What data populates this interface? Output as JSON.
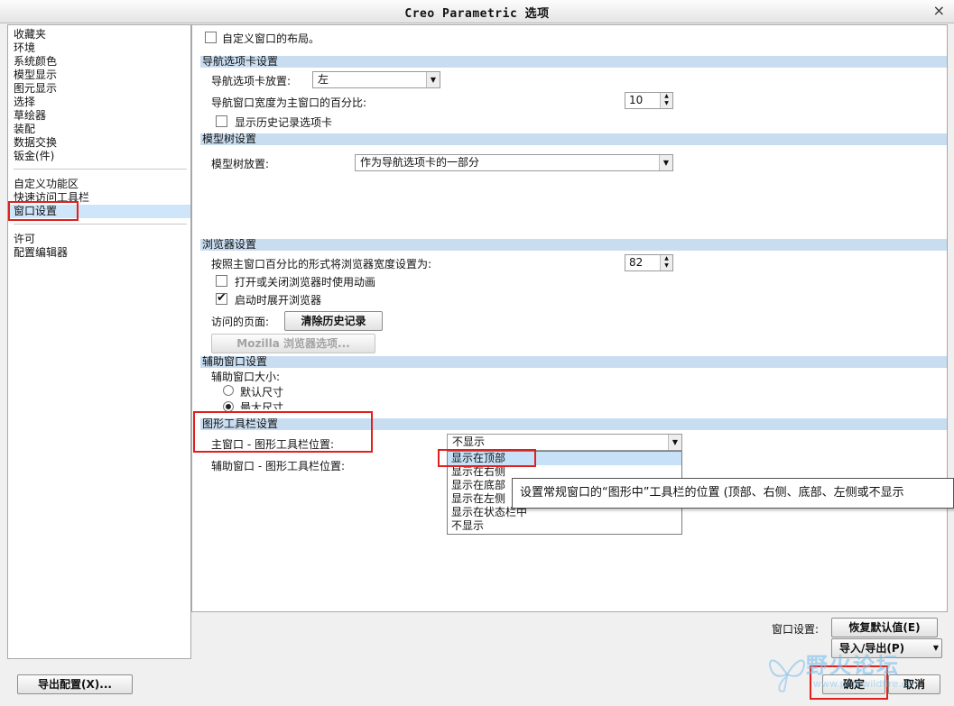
{
  "window": {
    "title": "Creo Parametric 选项",
    "close_glyph": "×"
  },
  "left_nav": {
    "group1": [
      "收藏夹",
      "环境",
      "系统颜色",
      "模型显示",
      "图元显示",
      "选择",
      "草绘器",
      "装配",
      "数据交换",
      "钣金(件)"
    ],
    "group2": [
      "自定义功能区",
      "快速访问工具栏",
      "窗口设置"
    ],
    "group3": [
      "许可",
      "配置编辑器"
    ],
    "selected": "窗口设置"
  },
  "main": {
    "custom_layout_label": "自定义窗口的布局。",
    "nav_section": {
      "header": "导航选项卡设置",
      "placement_label": "导航选项卡放置:",
      "placement_value": "左",
      "width_label": "导航窗口宽度为主窗口的百分比:",
      "width_value": "10",
      "history_label": "显示历史记录选项卡"
    },
    "tree_section": {
      "header": "模型树设置",
      "placement_label": "模型树放置:",
      "placement_value": "作为导航选项卡的一部分"
    },
    "browser_section": {
      "header": "浏览器设置",
      "width_label": "按照主窗口百分比的形式将浏览器宽度设置为:",
      "width_value": "82",
      "animate_label": "打开或关闭浏览器时使用动画",
      "expand_label": "启动时展开浏览器",
      "visited_label": "访问的页面:",
      "clear_history_label": "清除历史记录",
      "mozilla_label": "Mozilla 浏览器选项..."
    },
    "aux_section": {
      "header": "辅助窗口设置",
      "size_label": "辅助窗口大小:",
      "default_size_label": "默认尺寸",
      "max_size_label": "最大尺寸"
    },
    "graphics_section": {
      "header": "图形工具栏设置",
      "main_label": "主窗口 - 图形工具栏位置:",
      "main_value": "不显示",
      "aux_label": "辅助窗口 - 图形工具栏位置:",
      "options": [
        "显示在顶部",
        "显示在右侧",
        "显示在底部",
        "显示在左侧",
        "显示在状态栏中",
        "不显示"
      ]
    },
    "tooltip": "设置常规窗口的“图形中”工具栏的位置 (顶部、右侧、底部、左侧或不显示"
  },
  "footer": {
    "window_settings_label": "窗口设置:",
    "restore_defaults_label": "恢复默认值(E)",
    "import_export_label": "导入/导出(P)",
    "export_config_label": "导出配置(X)...",
    "ok_label": "确定",
    "cancel_label": "取消"
  },
  "watermark": {
    "text": "野火论坛",
    "url": "www.proewildfire.cn"
  }
}
